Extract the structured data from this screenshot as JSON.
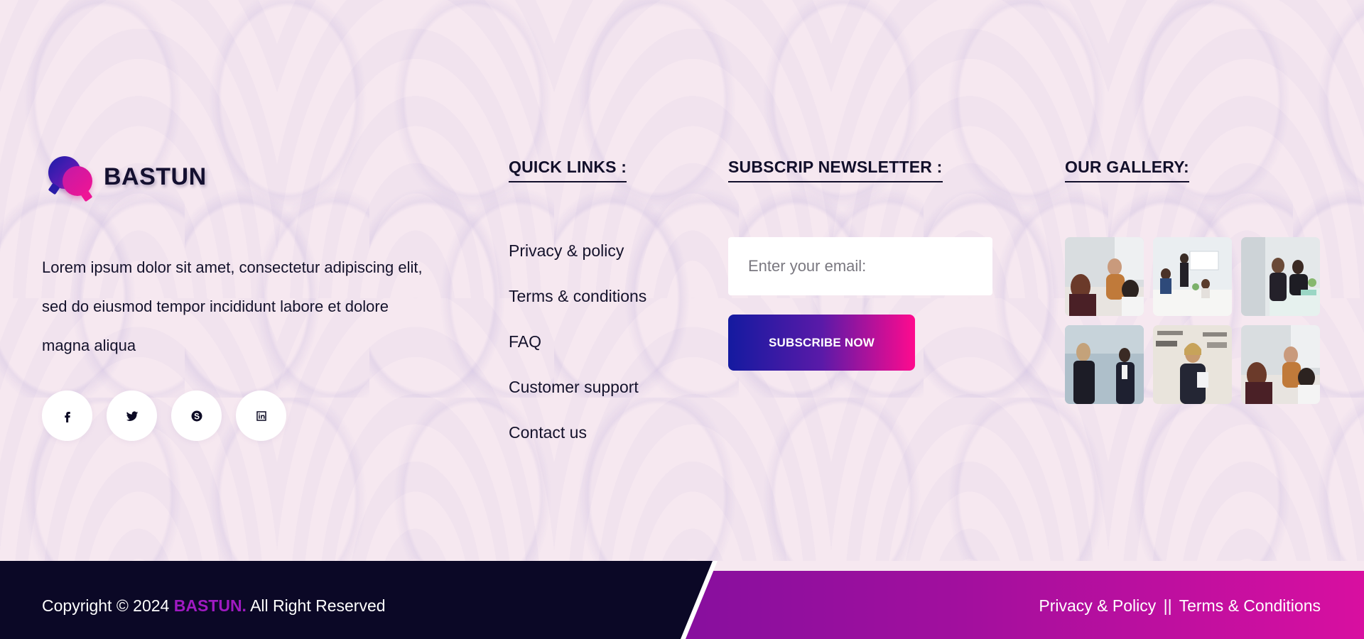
{
  "brand": {
    "name": "BASTUN",
    "description": "Lorem ipsum dolor sit amet, consectetur adipiscing elit, sed do eiusmod tempor incididunt labore et dolore magna aliqua"
  },
  "socials": [
    {
      "icon": "facebook-icon"
    },
    {
      "icon": "twitter-icon"
    },
    {
      "icon": "skype-icon"
    },
    {
      "icon": "linkedin-icon"
    }
  ],
  "quick_links": {
    "title": "QUICK LINKS :",
    "items": [
      "Privacy & policy",
      "Terms & conditions",
      "FAQ",
      "Customer support",
      "Contact us"
    ]
  },
  "newsletter": {
    "title": "SUBSCRIP NEWSLETTER :",
    "placeholder": "Enter your email:",
    "button_label": "SUBSCRIBE NOW"
  },
  "gallery": {
    "title": "OUR GALLERY:",
    "images": [
      "gallery-photo-1",
      "gallery-photo-2",
      "gallery-photo-3",
      "gallery-photo-4",
      "gallery-photo-5",
      "gallery-photo-6"
    ]
  },
  "footer": {
    "copyright_prefix": "Copyright © 2024",
    "copyright_brand": "BASTUN.",
    "copyright_suffix": "All Right Reserved",
    "privacy_link": "Privacy & Policy",
    "separator": "||",
    "terms_link": "Terms & Conditions"
  },
  "colors": {
    "background": "#f6e8f0",
    "dark": "#0b0826",
    "accent_purple": "#a01ac2",
    "accent_pink": "#ff0a8e",
    "accent_blue": "#141aa0"
  }
}
